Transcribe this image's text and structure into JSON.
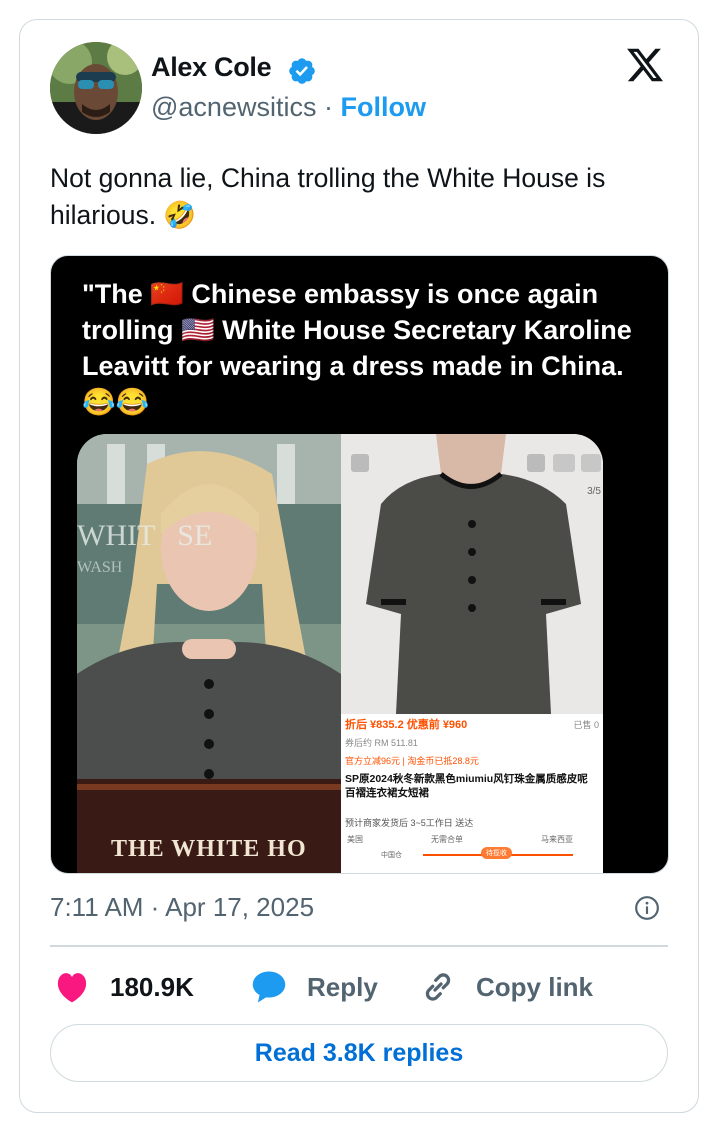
{
  "author": {
    "name": "Alex Cole",
    "handle": "@acnewsitics",
    "separator": "·",
    "follow_label": "Follow"
  },
  "tweet": {
    "text": "Not gonna lie, China trolling the White House is hilarious. 🤣"
  },
  "media": {
    "caption": "\"The 🇨🇳 Chinese embassy is once again trolling 🇺🇸 White House Secretary Karoline Leavitt for wearing a dress made in China. 😂😂",
    "left_sign_top": "WHIT   SE",
    "left_sign_mid": "WASH",
    "left_podium": "THE WHITE HO",
    "product": {
      "page_count": "3/5",
      "price_line": "折后 ¥835.2  优惠前 ¥960",
      "sold": "已售 0",
      "coupon_line": "券后约 RM 511.81",
      "discount_line": "官方立减96元 | 淘金币已抵28.8元",
      "title": "SP原2024秋冬新款黑色miumiu风钉珠金属质感皮呢百褶连衣裙女短裙",
      "shipping": "预计商家发货后 3~5工作日 送达",
      "route": [
        "美国",
        "无需合单",
        "马来西亚"
      ],
      "route_sub": [
        "中国仓",
        "待揽收"
      ]
    }
  },
  "meta": {
    "timestamp": "7:11 AM · Apr 17, 2025"
  },
  "actions": {
    "likes": "180.9K",
    "reply_label": "Reply",
    "copy_label": "Copy link",
    "read_replies": "Read 3.8K replies"
  },
  "colors": {
    "accent": "#1d9bf0",
    "like": "#f91880",
    "text": "#0f1419",
    "muted": "#536471",
    "border": "#cfd9de"
  },
  "icons": [
    "verified-badge-icon",
    "x-logo-icon",
    "info-icon",
    "heart-icon",
    "reply-bubble-icon",
    "link-icon"
  ]
}
